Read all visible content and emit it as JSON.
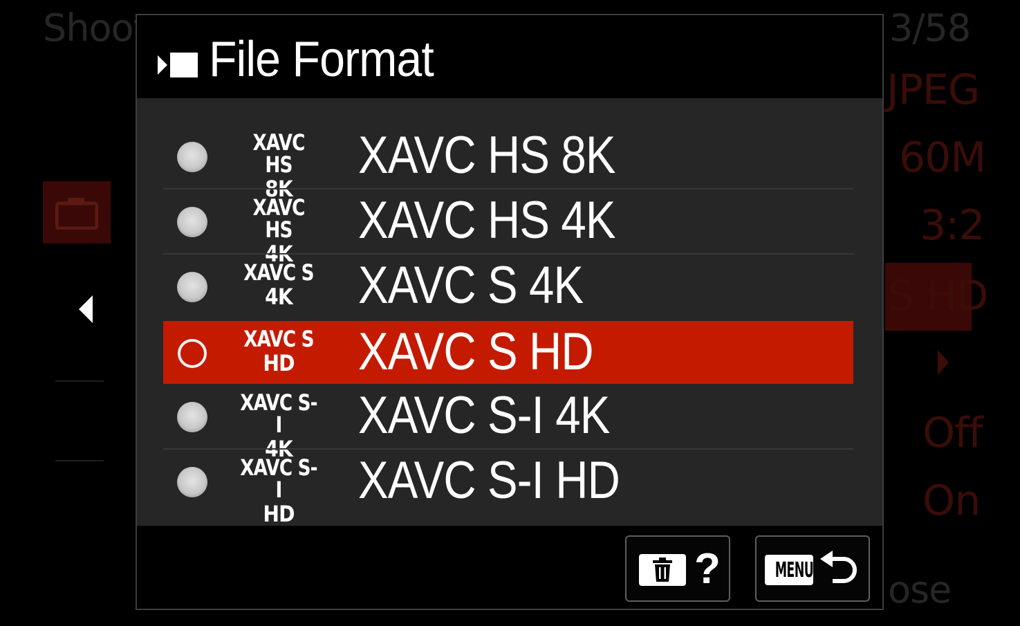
{
  "background": {
    "shooting_label": "Shoot",
    "page_counter": "3/58",
    "settings": [
      "JPEG",
      "60M",
      "3:2",
      "S HD",
      "Off",
      "On"
    ],
    "close_label": "ose"
  },
  "dialog": {
    "title": "File Format",
    "icon": "movie-icon"
  },
  "options": [
    {
      "badge_line1": "XAVC HS",
      "badge_line2": "8K",
      "label": "XAVC HS 8K",
      "selected": false
    },
    {
      "badge_line1": "XAVC HS",
      "badge_line2": "4K",
      "label": "XAVC HS 4K",
      "selected": false
    },
    {
      "badge_line1": "XAVC S",
      "badge_line2": "4K",
      "label": "XAVC S 4K",
      "selected": false
    },
    {
      "badge_line1": "XAVC S",
      "badge_line2": "HD",
      "label": "XAVC S HD",
      "selected": true
    },
    {
      "badge_line1": "XAVC S-I",
      "badge_line2": "4K",
      "label": "XAVC S-I 4K",
      "selected": false
    },
    {
      "badge_line1": "XAVC S-I",
      "badge_line2": "HD",
      "label": "XAVC S-I HD",
      "selected": false
    }
  ],
  "footer": {
    "help_label": "?",
    "menu_label": "MENU"
  },
  "colors": {
    "selected_row": "#c41a00",
    "panel": "#262626"
  }
}
